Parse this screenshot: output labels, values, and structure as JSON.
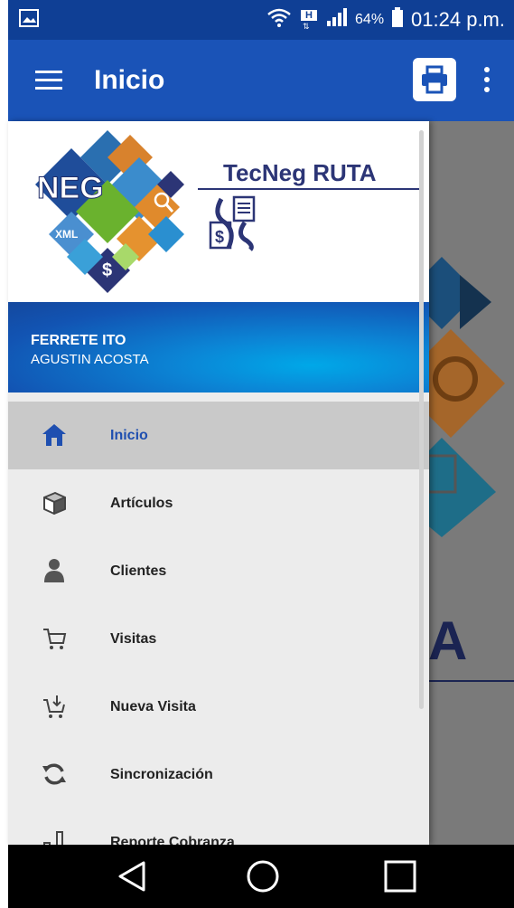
{
  "status_bar": {
    "battery": "64%",
    "time": "01:24 p.m.",
    "net_badge": "H"
  },
  "app_bar": {
    "title": "Inicio",
    "menu_icon": "hamburger-icon",
    "print_icon": "printer-icon",
    "more_icon": "more-vert-icon"
  },
  "drawer": {
    "brand": {
      "logo_text": "NEG",
      "title": "TecNeg RUTA",
      "xml_label": "XML"
    },
    "user": {
      "company": "FERRETE ITO",
      "name": "AGUSTIN ACOSTA"
    },
    "menu": [
      {
        "label": "Inicio",
        "icon": "home-icon",
        "active": true
      },
      {
        "label": "Artículos",
        "icon": "box-icon",
        "active": false
      },
      {
        "label": "Clientes",
        "icon": "person-icon",
        "active": false
      },
      {
        "label": "Visitas",
        "icon": "cart-icon",
        "active": false
      },
      {
        "label": "Nueva Visita",
        "icon": "cart-add-icon",
        "active": false
      },
      {
        "label": "Sincronización",
        "icon": "sync-icon",
        "active": false
      },
      {
        "label": "Reporte Cobranza",
        "icon": "report-icon",
        "active": false
      }
    ]
  },
  "background": {
    "partial_title": "A"
  },
  "colors": {
    "status_bar": "#0f3f95",
    "app_bar": "#1a53b7",
    "active_label": "#1f4fb0",
    "brand_navy": "#2c3576"
  }
}
